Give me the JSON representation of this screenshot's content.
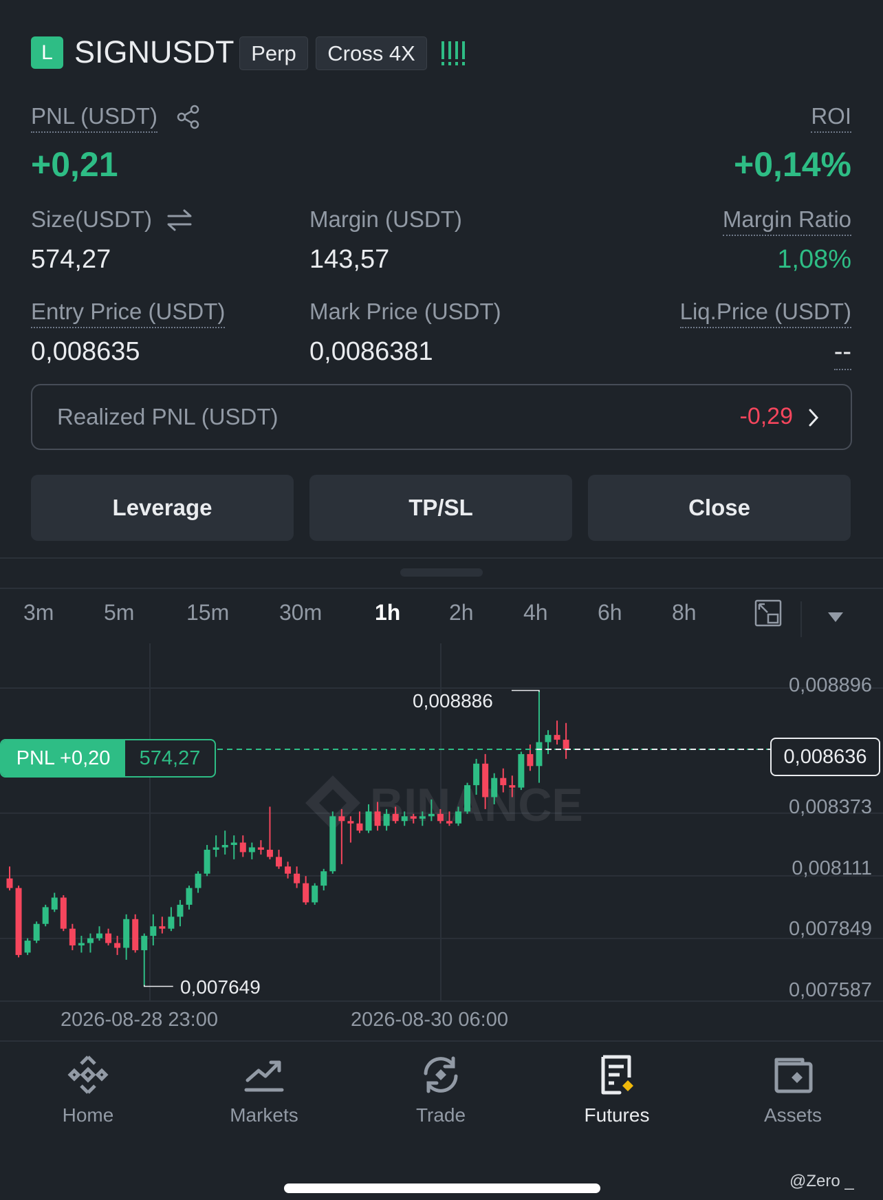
{
  "header": {
    "side_badge": "L",
    "symbol": "SIGNUSDT",
    "contract_type": "Perp",
    "margin_mode": "Cross 4X",
    "strength_icon": "signal-bars-icon"
  },
  "pnl": {
    "label": "PNL (USDT)",
    "value": "+0,21",
    "share_icon": "share-icon"
  },
  "roi": {
    "label": "ROI",
    "value": "+0,14%"
  },
  "size": {
    "label": "Size(USDT)",
    "value": "574,27",
    "swap_icon": "swap-icon"
  },
  "margin": {
    "label": "Margin (USDT)",
    "value": "143,57"
  },
  "margin_ratio": {
    "label": "Margin Ratio",
    "value": "1,08%"
  },
  "entry_price": {
    "label": "Entry Price (USDT)",
    "value": "0,008635"
  },
  "mark_price": {
    "label": "Mark Price (USDT)",
    "value": "0,0086381"
  },
  "liq_price": {
    "label": "Liq.Price (USDT)",
    "value": "--"
  },
  "realized": {
    "label": "Realized PNL (USDT)",
    "value": "-0,29"
  },
  "buttons": {
    "leverage": "Leverage",
    "tpsl": "TP/SL",
    "close": "Close"
  },
  "timeframes": [
    "3m",
    "5m",
    "15m",
    "30m",
    "1h",
    "2h",
    "4h",
    "6h",
    "8h"
  ],
  "active_timeframe": "1h",
  "chart": {
    "y_ticks": [
      "0,008896",
      "0,008373",
      "0,008111",
      "0,007849",
      "0,007587"
    ],
    "current_price": "0,008636",
    "high_label": "0,008886",
    "low_label": "0,007649",
    "pnl_tag": "PNL +0,20",
    "size_tag": "574,27",
    "x_ticks": [
      "2026-08-28 23:00",
      "2026-08-30 06:00"
    ],
    "watermark": "BINANCE"
  },
  "chart_data": {
    "type": "candlestick",
    "interval": "1h",
    "ylim": [
      0.007587,
      0.008896
    ],
    "candles": [
      {
        "o": 0.0081,
        "h": 0.00815,
        "l": 0.00805,
        "c": 0.00806
      },
      {
        "o": 0.00806,
        "h": 0.00807,
        "l": 0.00777,
        "c": 0.00778
      },
      {
        "o": 0.00779,
        "h": 0.00785,
        "l": 0.00778,
        "c": 0.00784
      },
      {
        "o": 0.00784,
        "h": 0.00792,
        "l": 0.00783,
        "c": 0.00791
      },
      {
        "o": 0.00791,
        "h": 0.00799,
        "l": 0.0079,
        "c": 0.00798
      },
      {
        "o": 0.00797,
        "h": 0.00804,
        "l": 0.00796,
        "c": 0.00802
      },
      {
        "o": 0.00802,
        "h": 0.00803,
        "l": 0.00788,
        "c": 0.00789
      },
      {
        "o": 0.00789,
        "h": 0.00791,
        "l": 0.0078,
        "c": 0.00782
      },
      {
        "o": 0.00782,
        "h": 0.00786,
        "l": 0.00779,
        "c": 0.00783
      },
      {
        "o": 0.00783,
        "h": 0.00787,
        "l": 0.00779,
        "c": 0.00785
      },
      {
        "o": 0.00785,
        "h": 0.0079,
        "l": 0.00784,
        "c": 0.00787
      },
      {
        "o": 0.00787,
        "h": 0.00789,
        "l": 0.00782,
        "c": 0.00783
      },
      {
        "o": 0.00783,
        "h": 0.00786,
        "l": 0.00778,
        "c": 0.00781
      },
      {
        "o": 0.00781,
        "h": 0.00795,
        "l": 0.00776,
        "c": 0.00793
      },
      {
        "o": 0.00793,
        "h": 0.00795,
        "l": 0.00779,
        "c": 0.0078
      },
      {
        "o": 0.0078,
        "h": 0.00787,
        "l": 0.007649,
        "c": 0.00786
      },
      {
        "o": 0.00786,
        "h": 0.00795,
        "l": 0.00782,
        "c": 0.0079
      },
      {
        "o": 0.0079,
        "h": 0.00794,
        "l": 0.00787,
        "c": 0.00789
      },
      {
        "o": 0.00789,
        "h": 0.00798,
        "l": 0.00788,
        "c": 0.00794
      },
      {
        "o": 0.00794,
        "h": 0.00801,
        "l": 0.0079,
        "c": 0.00799
      },
      {
        "o": 0.00799,
        "h": 0.00807,
        "l": 0.00797,
        "c": 0.00806
      },
      {
        "o": 0.00806,
        "h": 0.00813,
        "l": 0.00804,
        "c": 0.00812
      },
      {
        "o": 0.00812,
        "h": 0.00824,
        "l": 0.00811,
        "c": 0.00822
      },
      {
        "o": 0.00822,
        "h": 0.00828,
        "l": 0.00819,
        "c": 0.00823
      },
      {
        "o": 0.00823,
        "h": 0.0083,
        "l": 0.0082,
        "c": 0.00824
      },
      {
        "o": 0.00824,
        "h": 0.00828,
        "l": 0.00818,
        "c": 0.00825
      },
      {
        "o": 0.00825,
        "h": 0.00828,
        "l": 0.00819,
        "c": 0.00821
      },
      {
        "o": 0.00821,
        "h": 0.00825,
        "l": 0.00818,
        "c": 0.00823
      },
      {
        "o": 0.00823,
        "h": 0.00826,
        "l": 0.0082,
        "c": 0.00822
      },
      {
        "o": 0.00822,
        "h": 0.0084,
        "l": 0.00818,
        "c": 0.00819
      },
      {
        "o": 0.00819,
        "h": 0.00822,
        "l": 0.00814,
        "c": 0.00815
      },
      {
        "o": 0.00815,
        "h": 0.00817,
        "l": 0.0081,
        "c": 0.00812
      },
      {
        "o": 0.00812,
        "h": 0.00815,
        "l": 0.00806,
        "c": 0.00808
      },
      {
        "o": 0.00808,
        "h": 0.00811,
        "l": 0.00799,
        "c": 0.008
      },
      {
        "o": 0.008,
        "h": 0.00808,
        "l": 0.00799,
        "c": 0.00807
      },
      {
        "o": 0.00807,
        "h": 0.00814,
        "l": 0.00805,
        "c": 0.00813
      },
      {
        "o": 0.00813,
        "h": 0.00838,
        "l": 0.00812,
        "c": 0.00836
      },
      {
        "o": 0.00836,
        "h": 0.00839,
        "l": 0.00816,
        "c": 0.00834
      },
      {
        "o": 0.00834,
        "h": 0.00836,
        "l": 0.00825,
        "c": 0.00833
      },
      {
        "o": 0.00833,
        "h": 0.00838,
        "l": 0.00829,
        "c": 0.0083
      },
      {
        "o": 0.0083,
        "h": 0.00841,
        "l": 0.00829,
        "c": 0.00838
      },
      {
        "o": 0.00838,
        "h": 0.00842,
        "l": 0.0083,
        "c": 0.00832
      },
      {
        "o": 0.00832,
        "h": 0.00839,
        "l": 0.0083,
        "c": 0.00837
      },
      {
        "o": 0.00837,
        "h": 0.0084,
        "l": 0.00833,
        "c": 0.00834
      },
      {
        "o": 0.00834,
        "h": 0.00838,
        "l": 0.00832,
        "c": 0.00836
      },
      {
        "o": 0.00836,
        "h": 0.00837,
        "l": 0.00833,
        "c": 0.00835
      },
      {
        "o": 0.00835,
        "h": 0.00838,
        "l": 0.00832,
        "c": 0.00836
      },
      {
        "o": 0.00836,
        "h": 0.00843,
        "l": 0.00834,
        "c": 0.00837
      },
      {
        "o": 0.00837,
        "h": 0.00839,
        "l": 0.00833,
        "c": 0.00834
      },
      {
        "o": 0.00834,
        "h": 0.00838,
        "l": 0.00832,
        "c": 0.00833
      },
      {
        "o": 0.00833,
        "h": 0.0084,
        "l": 0.00832,
        "c": 0.00838
      },
      {
        "o": 0.00838,
        "h": 0.0085,
        "l": 0.00837,
        "c": 0.00849
      },
      {
        "o": 0.00849,
        "h": 0.0086,
        "l": 0.00845,
        "c": 0.00858
      },
      {
        "o": 0.00858,
        "h": 0.00862,
        "l": 0.00839,
        "c": 0.00844
      },
      {
        "o": 0.00844,
        "h": 0.00854,
        "l": 0.00841,
        "c": 0.00852
      },
      {
        "o": 0.00852,
        "h": 0.00856,
        "l": 0.00846,
        "c": 0.00849
      },
      {
        "o": 0.00849,
        "h": 0.00853,
        "l": 0.00844,
        "c": 0.00848
      },
      {
        "o": 0.00848,
        "h": 0.00863,
        "l": 0.00847,
        "c": 0.00862
      },
      {
        "o": 0.00862,
        "h": 0.00866,
        "l": 0.00855,
        "c": 0.00857
      },
      {
        "o": 0.00857,
        "h": 0.008886,
        "l": 0.0085,
        "c": 0.00867
      },
      {
        "o": 0.00867,
        "h": 0.00872,
        "l": 0.00862,
        "c": 0.0087
      },
      {
        "o": 0.0087,
        "h": 0.00876,
        "l": 0.00866,
        "c": 0.00868
      },
      {
        "o": 0.00868,
        "h": 0.00875,
        "l": 0.0086,
        "c": 0.00864
      }
    ]
  },
  "nav": [
    {
      "label": "Home",
      "icon": "binance-logo-icon",
      "active": false
    },
    {
      "label": "Markets",
      "icon": "chart-up-icon",
      "active": false
    },
    {
      "label": "Trade",
      "icon": "trade-swap-icon",
      "active": false
    },
    {
      "label": "Futures",
      "icon": "futures-document-icon",
      "active": true
    },
    {
      "label": "Assets",
      "icon": "wallet-icon",
      "active": false
    }
  ],
  "footer_watermark": "@Zero _",
  "colors": {
    "up": "#2ebd85",
    "down": "#f6465d",
    "bg": "#1e2329",
    "panel": "#2b3139"
  }
}
